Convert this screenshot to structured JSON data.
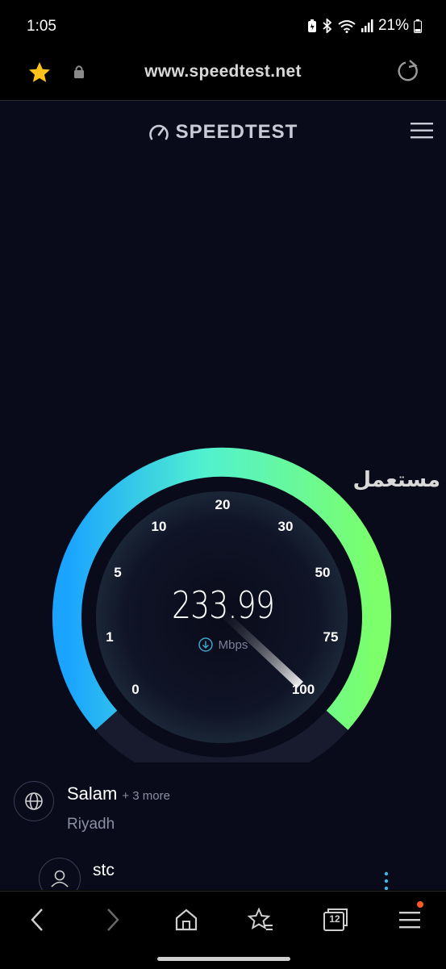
{
  "status": {
    "time": "1:05",
    "battery_pct": "21%"
  },
  "browser": {
    "url": "www.speedtest.net",
    "tab_count": "12"
  },
  "header": {
    "logo": "SPEEDTEST"
  },
  "gauge": {
    "reading": "233.99",
    "unit": "Mbps",
    "ticks": [
      "0",
      "1",
      "5",
      "10",
      "20",
      "30",
      "50",
      "75",
      "100"
    ],
    "colors": {
      "start": "#1ea4ff",
      "mid": "#55f0c7",
      "end": "#7dff6a",
      "background": "#0a0b1a"
    }
  },
  "watermark": "مستعمل",
  "server": {
    "name": "Salam",
    "more": "+ 3 more",
    "location": "Riyadh"
  },
  "provider": {
    "name": "stc"
  }
}
